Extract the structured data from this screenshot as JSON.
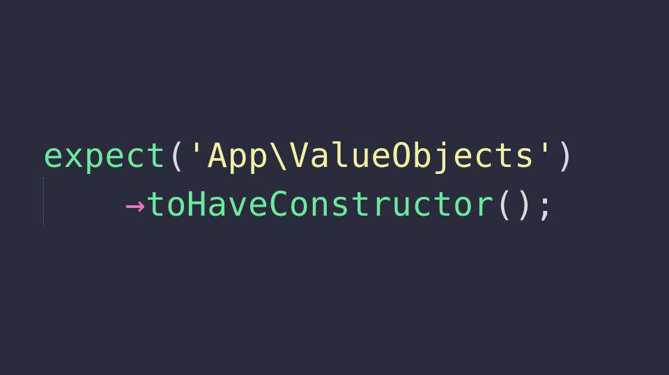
{
  "code": {
    "line1": {
      "func": "expect",
      "open_paren": "(",
      "string": "'App\\ValueObjects'",
      "close_paren": ")"
    },
    "line2": {
      "indent": "    ",
      "arrow": "→",
      "method": "toHaveConstructor",
      "open_paren": "(",
      "close_paren": ")",
      "semicolon": ";"
    }
  }
}
